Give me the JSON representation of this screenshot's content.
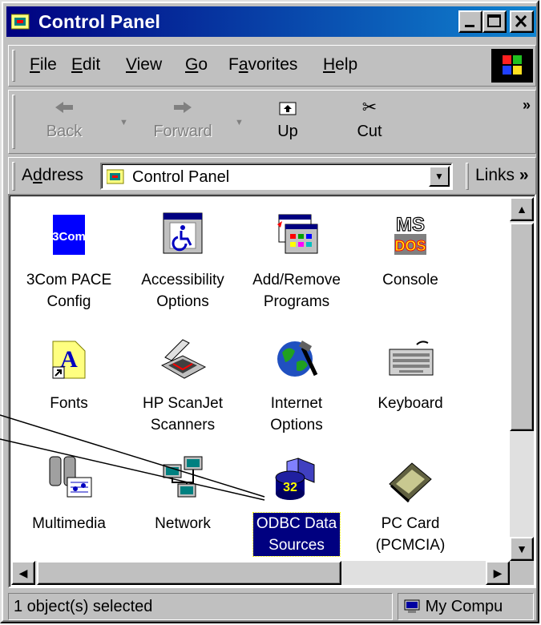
{
  "window": {
    "title": "Control Panel"
  },
  "menu": [
    {
      "label": "File",
      "u": "F",
      "rest": "ile"
    },
    {
      "label": "Edit",
      "u": "E",
      "rest": "dit"
    },
    {
      "label": "View",
      "u": "V",
      "rest": "iew"
    },
    {
      "label": "Go",
      "u": "G",
      "rest": "o"
    },
    {
      "label": "Favorites",
      "pre": "F",
      "u": "a",
      "rest": "vorites"
    },
    {
      "label": "Help",
      "u": "H",
      "rest": "elp"
    }
  ],
  "toolbar": {
    "back": "Back",
    "forward": "Forward",
    "up": "Up",
    "cut": "Cut",
    "more": "»"
  },
  "address": {
    "label_pre": "A",
    "label_u": "d",
    "label_rest": "dress",
    "value": "Control Panel",
    "links": "Links",
    "links_more": "»"
  },
  "items": [
    {
      "line1": "3Com PACE",
      "line2": "Config",
      "icon": "3com-icon",
      "icon_text": "3Com"
    },
    {
      "line1": "Accessibility",
      "line2": "Options",
      "icon": "accessibility-icon"
    },
    {
      "line1": "Add/Remove",
      "line2": "Programs",
      "icon": "add-remove-icon"
    },
    {
      "line1": "Console",
      "line2": "",
      "icon": "console-icon",
      "icon_text_1": "MS",
      "icon_text_2": "DOS"
    },
    {
      "line1": "Fonts",
      "line2": "",
      "icon": "fonts-icon",
      "icon_text": "A"
    },
    {
      "line1": "HP ScanJet",
      "line2": "Scanners",
      "icon": "scanner-icon"
    },
    {
      "line1": "Internet",
      "line2": "Options",
      "icon": "internet-icon"
    },
    {
      "line1": "Keyboard",
      "line2": "",
      "icon": "keyboard-icon"
    },
    {
      "line1": "Multimedia",
      "line2": "",
      "icon": "multimedia-icon"
    },
    {
      "line1": "Network",
      "line2": "",
      "icon": "network-icon"
    },
    {
      "line1": "ODBC Data",
      "line2": "Sources",
      "icon": "odbc-icon",
      "icon_text": "32",
      "selected": true
    },
    {
      "line1": "PC Card",
      "line2": "(PCMCIA)",
      "icon": "pccard-icon"
    }
  ],
  "status": {
    "text": "1 object(s) selected",
    "zone": "My Compu"
  },
  "colors": {
    "title_start": "#000080",
    "title_end": "#1084d0",
    "selection": "#000080",
    "face": "#c0c0c0"
  }
}
